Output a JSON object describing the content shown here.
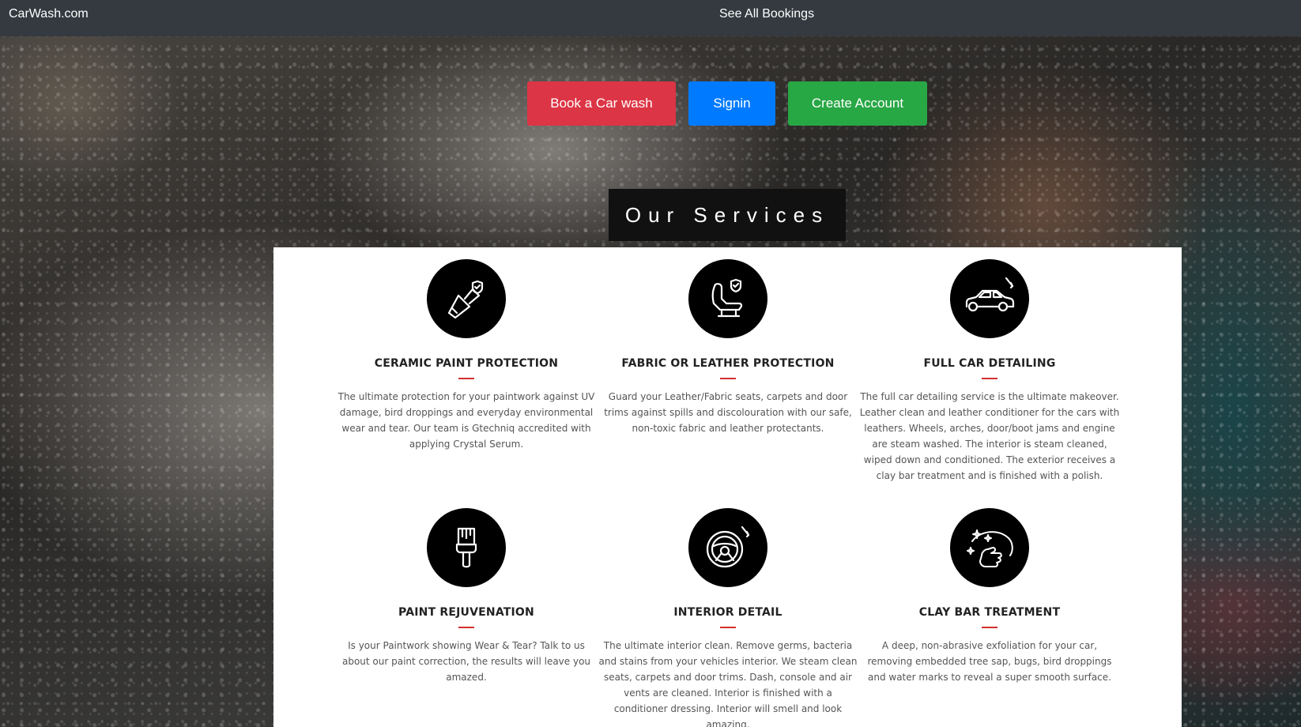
{
  "navbar": {
    "brand": "CarWash.com",
    "link_bookings": "See All Bookings"
  },
  "actions": {
    "book_label": "Book a Car wash",
    "signin_label": "Signin",
    "create_label": "Create Account"
  },
  "services": {
    "heading": "Our Services",
    "items": [
      {
        "icon": "brush-shield-icon",
        "title": "CERAMIC PAINT PROTECTION",
        "text": "The ultimate protection for your paintwork against UV damage, bird droppings and everyday environmental wear and tear. Our team is Gtechniq accredited with applying Crystal Serum."
      },
      {
        "icon": "seat-shield-icon",
        "title": "FABRIC OR LEATHER PROTECTION",
        "text": "Guard your Leather/Fabric seats, carpets and door trims against spills and discolouration with our safe, non-toxic fabric and leather protectants."
      },
      {
        "icon": "car-detailing-icon",
        "title": "FULL CAR DETAILING",
        "text": "The full car detailing service is the ultimate makeover. Leather clean and leather conditioner for the cars with leathers. Wheels, arches, door/boot jams and engine are steam washed. The interior is steam cleaned, wiped down and conditioned. The exterior receives a clay bar treatment and is finished with a polish."
      },
      {
        "icon": "paint-brush-icon",
        "title": "PAINT REJUVENATION",
        "text": "Is your Paintwork showing Wear & Tear? Talk to us about our paint correction, the results will leave you amazed."
      },
      {
        "icon": "steering-wheel-icon",
        "title": "INTERIOR DETAIL",
        "text": "The ultimate interior clean. Remove germs, bacteria and stains from your vehicles interior. We steam clean seats, carpets and door trims. Dash, console and air vents are cleaned. Interior is finished with a conditioner dressing. Interior will smell and look amazing."
      },
      {
        "icon": "sparkle-hand-icon",
        "title": "CLAY BAR TREATMENT",
        "text": "A deep, non-abrasive exfoliation for your car, removing embedded tree sap, bugs, bird droppings and water marks to reveal a super smooth surface."
      }
    ]
  },
  "colors": {
    "navbar": "#343a40",
    "book": "#dc3545",
    "signin": "#007bff",
    "create": "#28a745",
    "accent_rule": "#d32f2f"
  }
}
